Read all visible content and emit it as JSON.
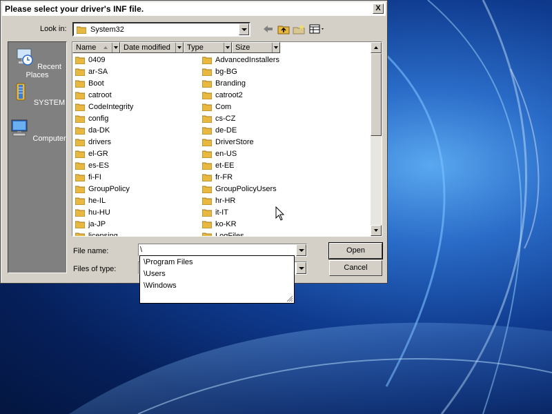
{
  "dialog": {
    "title": "Please select your driver's INF file.",
    "close_label": "X"
  },
  "toolbar": {
    "look_in_label": "Look in:",
    "look_in_value": "System32"
  },
  "places": [
    {
      "label": "Recent Places",
      "icon": "recent-places-icon"
    },
    {
      "label": "SYSTEM",
      "icon": "system-folder-icon"
    },
    {
      "label": "Computer",
      "icon": "computer-icon"
    }
  ],
  "columns": [
    "Name",
    "Date modified",
    "Type",
    "Size"
  ],
  "files_col1": [
    "0409",
    "ar-SA",
    "Boot",
    "catroot",
    "CodeIntegrity",
    "config",
    "da-DK",
    "drivers",
    "el-GR",
    "es-ES",
    "fi-FI",
    "GroupPolicy",
    "he-IL",
    "hu-HU",
    "ja-JP",
    "licensing"
  ],
  "files_col2": [
    "AdvancedInstallers",
    "bg-BG",
    "Branding",
    "catroot2",
    "Com",
    "cs-CZ",
    "de-DE",
    "DriverStore",
    "en-US",
    "et-EE",
    "fr-FR",
    "GroupPolicyUsers",
    "hr-HR",
    "it-IT",
    "ko-KR",
    "LogFiles"
  ],
  "form": {
    "file_name_label": "File name:",
    "file_name_value": "\\",
    "files_of_type_label": "Files of type:",
    "open_label": "Open",
    "cancel_label": "Cancel"
  },
  "autocomplete": [
    "\\Program Files",
    "\\Users",
    "\\Windows"
  ],
  "colors": {
    "dialog_bg": "#d4d0c8",
    "places_bg": "#808080",
    "folder": "#e8b840"
  }
}
